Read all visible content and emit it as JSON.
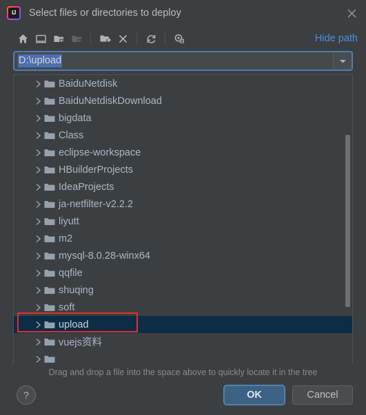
{
  "window": {
    "title": "Select files or directories to deploy",
    "app_icon": "intellij-idea-icon",
    "icon_text": "IJ",
    "close_icon": "close-icon"
  },
  "toolbar": {
    "buttons": [
      {
        "name": "home-icon",
        "label": "Home",
        "enabled": true
      },
      {
        "name": "desktop-icon",
        "label": "Desktop",
        "enabled": true
      },
      {
        "name": "project-folder-icon",
        "label": "Project Directory",
        "enabled": true
      },
      {
        "name": "module-folder-icon",
        "label": "Module Directory",
        "enabled": false
      },
      {
        "name": "new-folder-icon",
        "label": "New Folder",
        "enabled": true
      },
      {
        "name": "delete-icon",
        "label": "Delete",
        "enabled": true
      },
      {
        "name": "refresh-icon",
        "label": "Refresh",
        "enabled": true
      },
      {
        "name": "show-hidden-files-icon",
        "label": "Show Hidden Files and Directories",
        "enabled": true
      }
    ],
    "hide_path_label": "Hide path"
  },
  "path_combo": {
    "value": "D:\\upload",
    "selected": true,
    "dropdown_icon": "chevron-down-icon"
  },
  "tree": {
    "rows": [
      {
        "label": "BaiduNetdisk",
        "selected": false
      },
      {
        "label": "BaiduNetdiskDownload",
        "selected": false
      },
      {
        "label": "bigdata",
        "selected": false
      },
      {
        "label": "Class",
        "selected": false
      },
      {
        "label": "eclipse-workspace",
        "selected": false
      },
      {
        "label": "HBuilderProjects",
        "selected": false
      },
      {
        "label": "IdeaProjects",
        "selected": false
      },
      {
        "label": "ja-netfilter-v2.2.2",
        "selected": false
      },
      {
        "label": "liyutt",
        "selected": false
      },
      {
        "label": "m2",
        "selected": false
      },
      {
        "label": "mysql-8.0.28-winx64",
        "selected": false
      },
      {
        "label": "qqfile",
        "selected": false
      },
      {
        "label": "shuqing",
        "selected": false
      },
      {
        "label": "soft",
        "selected": false
      },
      {
        "label": "upload",
        "selected": true
      },
      {
        "label": "vuejs资料",
        "selected": false
      },
      {
        "label": "",
        "selected": false
      }
    ]
  },
  "hint": {
    "text": "Drag and drop a file into the space above to quickly locate it in the tree"
  },
  "footer": {
    "help_label": "?",
    "ok_label": "OK",
    "cancel_label": "Cancel"
  },
  "colors": {
    "dialog_background": "#3c3f41",
    "selection_background": "#0d2c45",
    "link_blue": "#4b8ee0",
    "annotation_red": "#e03030",
    "ok_button": "#3d6185",
    "text_primary": "#a9b7c6"
  }
}
